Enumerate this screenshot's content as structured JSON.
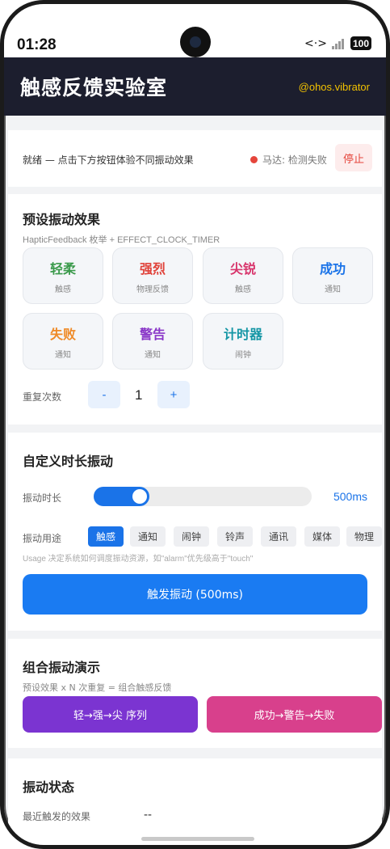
{
  "status_bar": {
    "time": "01:28",
    "battery": "100",
    "network_glyph": "<·>"
  },
  "header": {
    "title": "触感反馈实验室",
    "tag": "@ohos.vibrator"
  },
  "status": {
    "message": "就绪 — 点击下方按钮体验不同振动效果",
    "motor": "马达: 检测失败",
    "stop_label": "停止"
  },
  "preset": {
    "title": "预设振动效果",
    "subtitle": "HapticFeedback 枚举 + EFFECT_CLOCK_TIMER",
    "items": [
      {
        "name": "轻柔",
        "desc": "触感",
        "color": "#3a9a4b"
      },
      {
        "name": "强烈",
        "desc": "物理反馈",
        "color": "#e0423a"
      },
      {
        "name": "尖锐",
        "desc": "触感",
        "color": "#d8356c"
      },
      {
        "name": "成功",
        "desc": "通知",
        "color": "#1a73e8"
      },
      {
        "name": "失败",
        "desc": "通知",
        "color": "#ef8a27"
      },
      {
        "name": "警告",
        "desc": "通知",
        "color": "#8a37c8"
      },
      {
        "name": "计时器",
        "desc": "闹钟",
        "color": "#1596a5"
      }
    ],
    "repeat_label": "重复次数",
    "minus": "-",
    "plus": "+",
    "repeat_value": "1"
  },
  "custom": {
    "title": "自定义时长振动",
    "duration_label": "振动时长",
    "duration_value": "500ms",
    "duration_fraction": 0.19,
    "usage_label": "振动用途",
    "chips": [
      "触感",
      "通知",
      "闹钟",
      "铃声",
      "通讯",
      "媒体",
      "物理"
    ],
    "active_chip": 0,
    "usage_hint": "Usage 决定系统如何调度振动资源，如\"alarm\"优先级高于\"touch\"",
    "trigger_label": "触发振动 (500ms)"
  },
  "combo": {
    "title": "组合振动演示",
    "subtitle": "预设效果 x N 次重复 = 组合触感反馈",
    "buttons": [
      {
        "label": "轻→强→尖 序列",
        "color": "#7b34d1"
      },
      {
        "label": "成功→警告→失败",
        "color": "#d8408c"
      }
    ]
  },
  "state": {
    "title": "振动状态",
    "last_label": "最近触发的效果",
    "last_value": "--"
  }
}
